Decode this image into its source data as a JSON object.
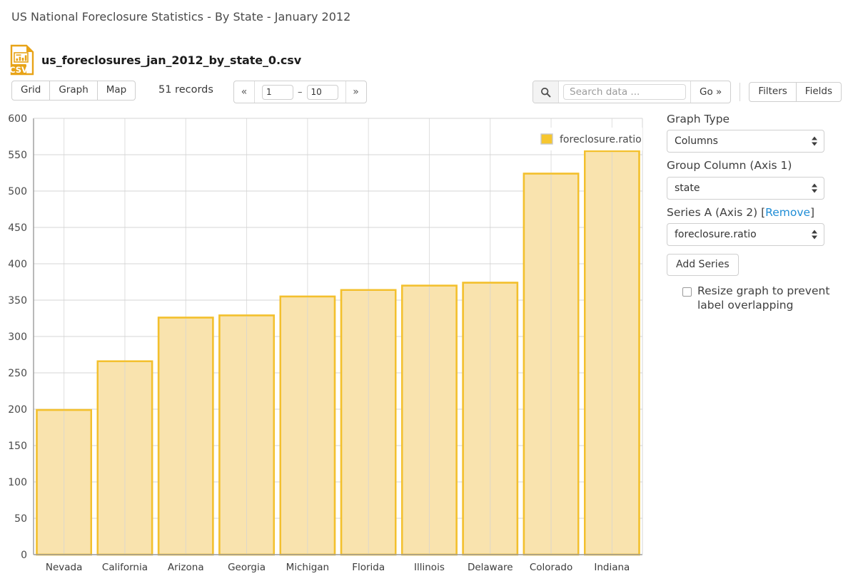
{
  "header": {
    "page_title": "US National Foreclosure Statistics - By State - January 2012",
    "file_icon": "csv-file-icon",
    "file_name": "us_foreclosures_jan_2012_by_state_0.csv"
  },
  "toolbar": {
    "view_buttons": [
      {
        "label": "Grid",
        "name": "view-grid"
      },
      {
        "label": "Graph",
        "name": "view-graph"
      },
      {
        "label": "Map",
        "name": "view-map"
      }
    ],
    "records_label": "51 records",
    "pager": {
      "prev_label": "«",
      "next_label": "»",
      "from_value": "1",
      "dash": "–",
      "to_value": "10"
    },
    "search": {
      "icon": "search-icon",
      "value": "",
      "placeholder": "Search data ...",
      "go_label": "Go »"
    },
    "filters_label": "Filters",
    "fields_label": "Fields"
  },
  "sidebar": {
    "graph_type_label": "Graph Type",
    "graph_type_value": "Columns",
    "group_column_label": "Group Column (Axis 1)",
    "group_column_value": "state",
    "series_a_label": "Series A (Axis 2) [",
    "series_a_remove": "Remove",
    "series_a_label_end": "]",
    "series_a_value": "foreclosure.ratio",
    "add_series_label": "Add Series",
    "resize_checkbox_checked": false,
    "resize_label": "Resize graph to prevent label overlapping"
  },
  "chart_data": {
    "type": "bar",
    "title": "",
    "xlabel": "",
    "ylabel": "",
    "categories": [
      "Nevada",
      "California",
      "Arizona",
      "Georgia",
      "Michigan",
      "Florida",
      "Illinois",
      "Delaware",
      "Colorado",
      "Indiana"
    ],
    "series": [
      {
        "name": "foreclosure.ratio",
        "values": [
          199,
          266,
          326,
          329,
          355,
          364,
          370,
          374,
          524,
          555
        ]
      }
    ],
    "ylim": [
      0,
      600
    ],
    "yticks": [
      0,
      50,
      100,
      150,
      200,
      250,
      300,
      350,
      400,
      450,
      500,
      550,
      600
    ],
    "ytick_labels": [
      "0",
      "50",
      "100",
      "150",
      "200",
      "250",
      "300",
      "350",
      "400",
      "450",
      "500",
      "550",
      "600"
    ],
    "grid": true,
    "legend": {
      "position": "top-right",
      "entries": [
        "foreclosure.ratio"
      ]
    },
    "colors": {
      "bar_fill": "#F9E3AE",
      "bar_stroke": "#F3C02D",
      "axis": "#9b9b9b",
      "grid": "#d4d4d4"
    }
  }
}
